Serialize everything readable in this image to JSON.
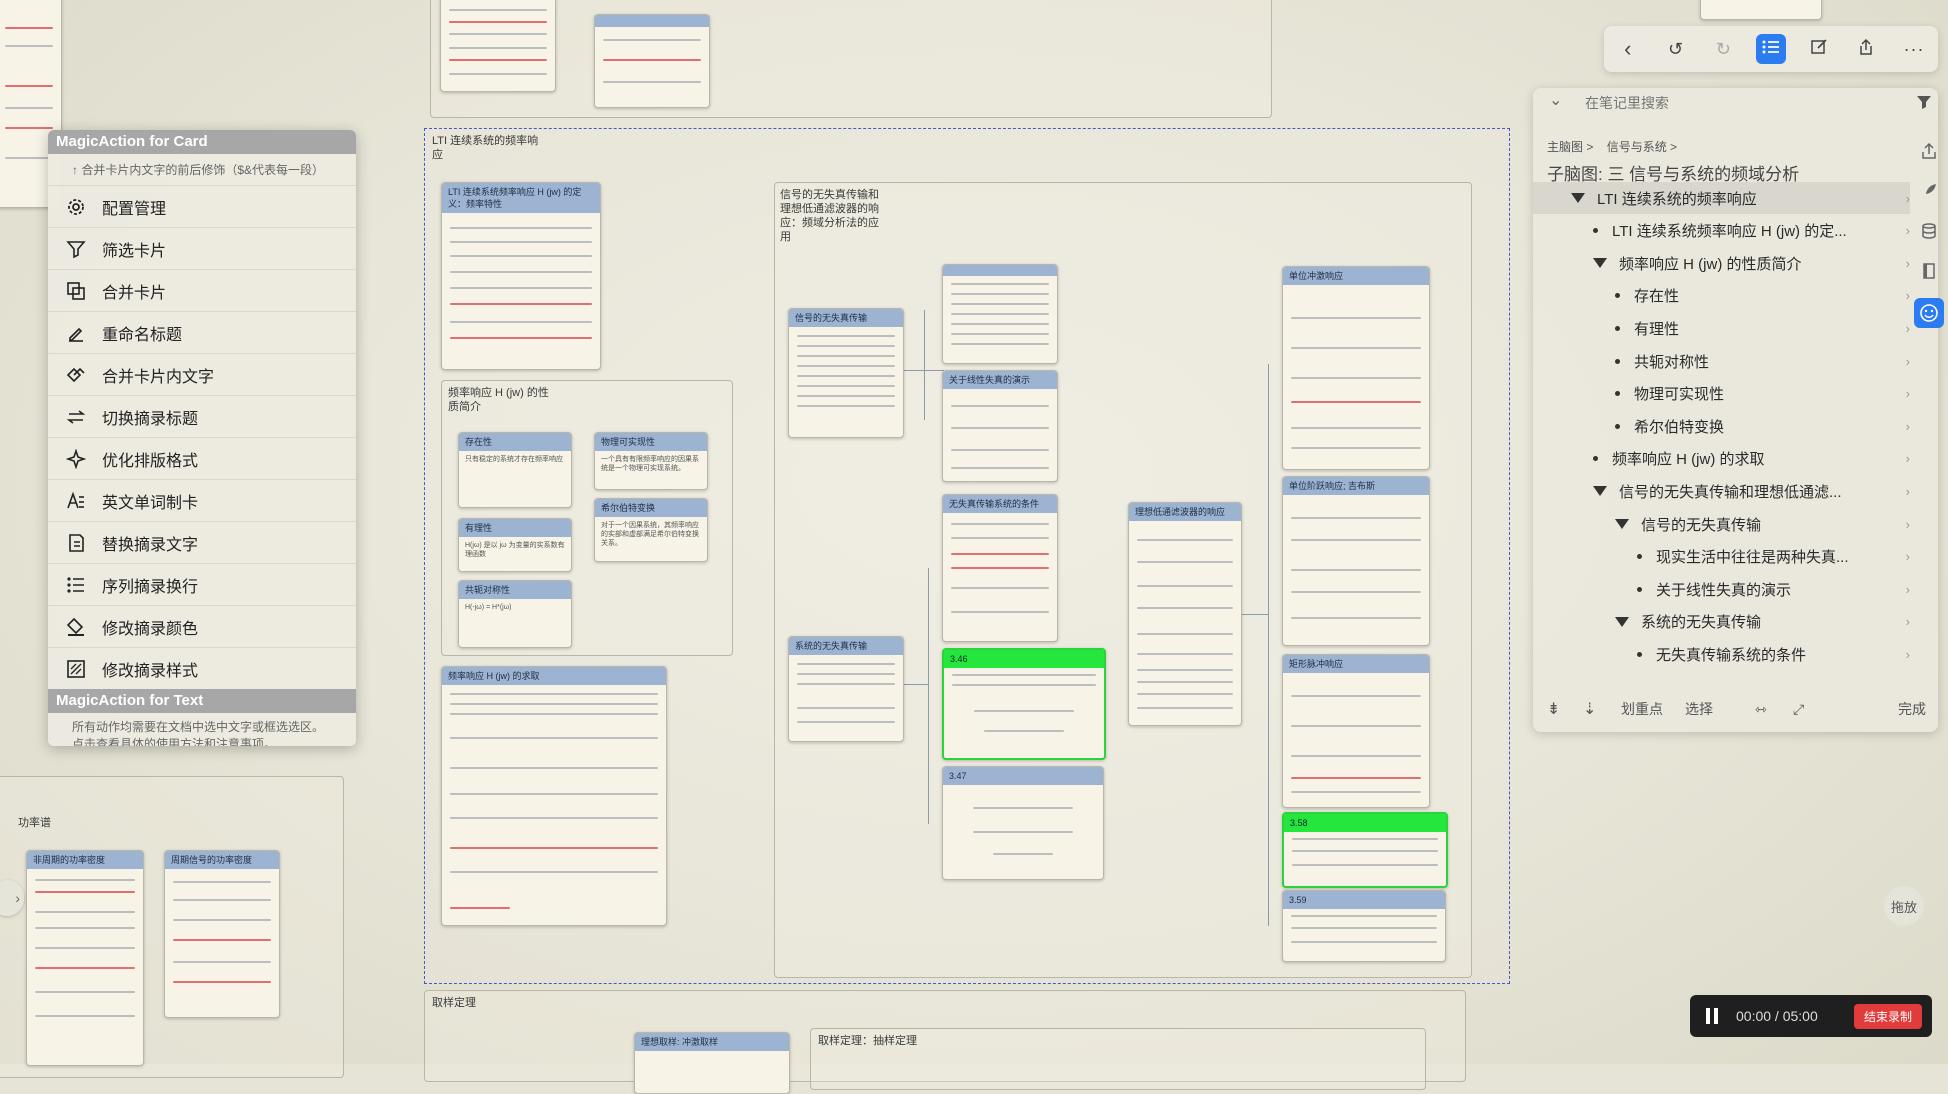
{
  "magic_action": {
    "card_header": "MagicAction for Card",
    "card_sub": "↑ 合并卡片内文字的前后修饰（$&代表每一段）",
    "items": [
      {
        "label": "配置管理",
        "icon": "gear-icon"
      },
      {
        "label": "筛选卡片",
        "icon": "filter-icon"
      },
      {
        "label": "合并卡片",
        "icon": "merge-icon"
      },
      {
        "label": "重命名标题",
        "icon": "rename-icon"
      },
      {
        "label": "合并卡片内文字",
        "icon": "merge-text-icon"
      },
      {
        "label": "切换摘录标题",
        "icon": "switch-icon"
      },
      {
        "label": "优化排版格式",
        "icon": "sparkle-icon"
      },
      {
        "label": "英文单词制卡",
        "icon": "word-card-icon"
      },
      {
        "label": "替换摘录文字",
        "icon": "replace-icon"
      },
      {
        "label": "序列摘录换行",
        "icon": "list-icon"
      },
      {
        "label": "修改摘录颜色",
        "icon": "paint-bucket-icon"
      },
      {
        "label": "修改摘录样式",
        "icon": "style-icon"
      }
    ],
    "text_header": "MagicAction for Text",
    "text_footer_1": "所有动作均需要在文档中选中文字或框选选区。",
    "text_footer_2": "点击查看具体的使用方法和注意事项。"
  },
  "mindmap": {
    "frame_main_title_1": "LTI 连续系统的频率响",
    "frame_main_title_2": "应",
    "frame_props_title_1": "频率响应 H (jw) 的性",
    "frame_props_title_2": "质简介",
    "frame_dist_title_1": "信号的无失真传输和",
    "frame_dist_title_2": "理想低通滤波器的响",
    "frame_dist_title_3": "应：频域分析法的应",
    "frame_dist_title_4": "用",
    "frame_power_title": "功率谱",
    "frame_sampling_title": "取样定理",
    "frame_sampling_inner": "取样定理：抽样定理",
    "cards": {
      "def": "LTI 连续系统频率响应 H (jw) 的定义：频率特性",
      "exist": "存在性",
      "exist_body": "只有稳定的系统才存在频率响应",
      "causal": "有理性",
      "causal_body": "H(jω) 是以 jω 为变量的实系数有理函数",
      "conj": "共轭对称性",
      "conj_body": "H(-jω) = H*(jω)",
      "realiz": "物理可实现性",
      "realiz_body": "一个具有有限频率响应的因果系统是一个物理可实现系统。",
      "hilbert": "希尔伯特变换",
      "hilbert_body": "对于一个因果系统，其频率响应的实部和虚部满足希尔伯特变换关系。",
      "solve": "频率响应 H (jw) 的求取",
      "dist_sig": "信号的无失真传输",
      "real_life": "现实生活中往往是两种失真",
      "linear_demo": "关于线性失真的演示",
      "cond": "无失真传输系统的条件",
      "sys_dist": "系统的无失真传输",
      "ex346": "3.46",
      "ex347": "3.47",
      "ideal_lp": "理想低通滤波器的响应",
      "impulse": "单位冲激响应",
      "step": "单位阶跃响应; 吉布斯",
      "rect": "矩形脉冲响应",
      "ex358": "3.58",
      "ex359": "3.59",
      "ideal_samp": "理想取样: 冲激取样",
      "power_np": "非周期的功率密度",
      "power_p": "周期信号的功率密度"
    }
  },
  "outline": {
    "search_placeholder": "在笔记里搜索",
    "breadcrumb_1": "主脑图 >",
    "breadcrumb_2": "信号与系统 >",
    "subtitle": "子脑图: 三 信号与系统的频域分析",
    "rows": [
      {
        "label": "LTI 连续系统的频率响应",
        "type": "tri",
        "indent": 0
      },
      {
        "label": "LTI 连续系统频率响应 H (jw) 的定...",
        "type": "dot",
        "indent": 1
      },
      {
        "label": "频率响应 H (jw) 的性质简介",
        "type": "tri",
        "indent": 1
      },
      {
        "label": "存在性",
        "type": "dot",
        "indent": 2
      },
      {
        "label": "有理性",
        "type": "dot",
        "indent": 2
      },
      {
        "label": "共轭对称性",
        "type": "dot",
        "indent": 2
      },
      {
        "label": "物理可实现性",
        "type": "dot",
        "indent": 2
      },
      {
        "label": "希尔伯特变换",
        "type": "dot",
        "indent": 2
      },
      {
        "label": "频率响应 H (jw) 的求取",
        "type": "dot",
        "indent": 1
      },
      {
        "label": "信号的无失真传输和理想低通滤...",
        "type": "tri",
        "indent": 1
      },
      {
        "label": "信号的无失真传输",
        "type": "tri",
        "indent": 2
      },
      {
        "label": "现实生活中往往是两种失真...",
        "type": "dot",
        "indent": 3
      },
      {
        "label": "关于线性失真的演示",
        "type": "dot",
        "indent": 3
      },
      {
        "label": "系统的无失真传输",
        "type": "tri",
        "indent": 2
      },
      {
        "label": "无失真传输系统的条件",
        "type": "dot",
        "indent": 3
      }
    ],
    "footer_mark": "划重点",
    "footer_select": "选择",
    "footer_done": "完成"
  },
  "side": {
    "drag_label": "拖放"
  },
  "recorder": {
    "time": "00:00 / 05:00",
    "stop_label": "结束录制"
  }
}
